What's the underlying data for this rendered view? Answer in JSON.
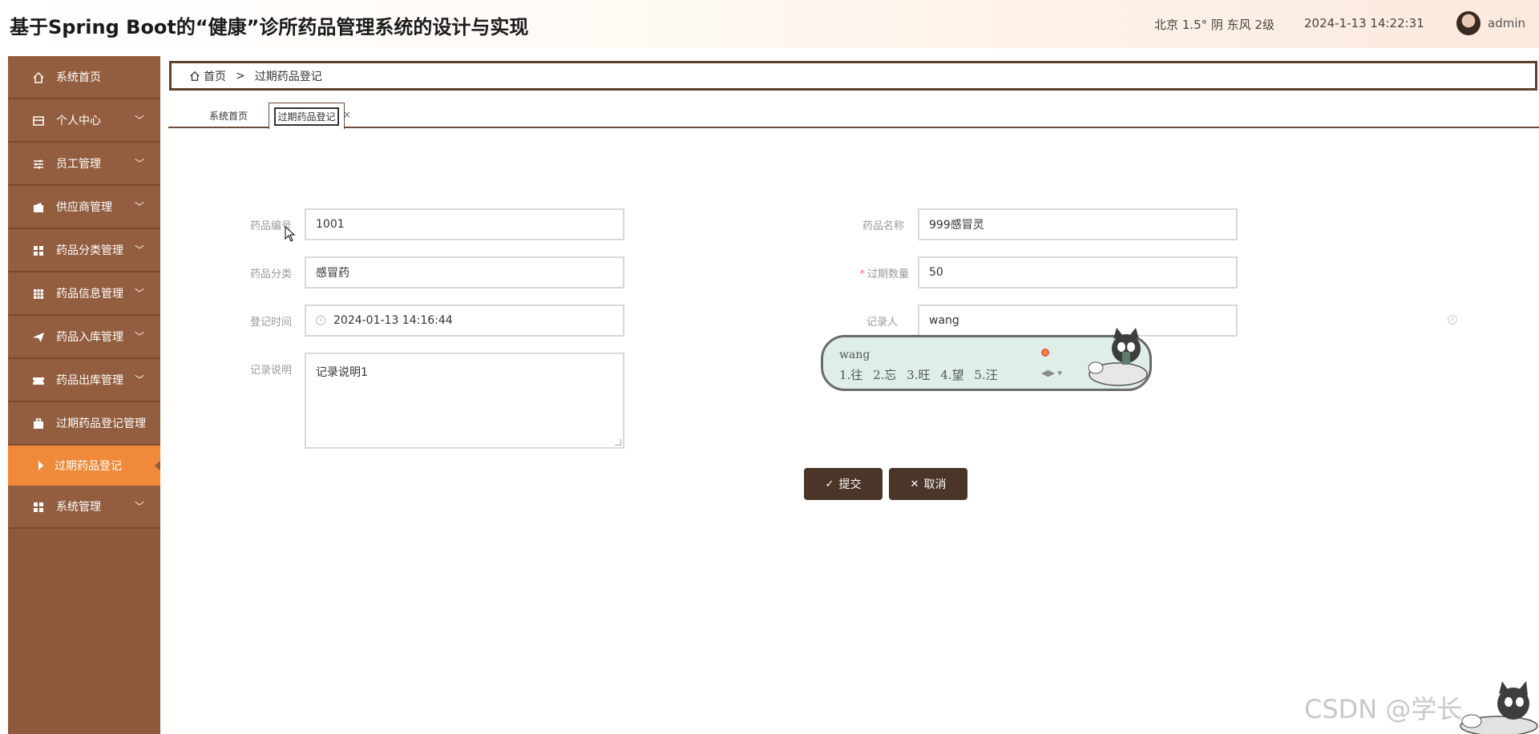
{
  "header": {
    "title": "基于Spring Boot的“健康”诊所药品管理系统的设计与实现",
    "weather": "北京  1.5°  阴  东风  2级",
    "datetime": "2024-1-13 14:22:31",
    "username": "admin"
  },
  "sidebar": {
    "items": [
      {
        "label": "系统首页",
        "icon": "home-icon"
      },
      {
        "label": "个人中心",
        "icon": "user-card-icon"
      },
      {
        "label": "员工管理",
        "icon": "sliders-icon"
      },
      {
        "label": "供应商管理",
        "icon": "wallet-icon"
      },
      {
        "label": "药品分类管理",
        "icon": "grid-icon"
      },
      {
        "label": "药品信息管理",
        "icon": "table-icon"
      },
      {
        "label": "药品入库管理",
        "icon": "send-icon"
      },
      {
        "label": "药品出库管理",
        "icon": "ticket-icon"
      },
      {
        "label": "过期药品登记管理",
        "icon": "briefcase-icon"
      }
    ],
    "active_sub": "过期药品登记",
    "bottom_item": {
      "label": "系统管理",
      "icon": "grid-icon"
    }
  },
  "breadcrumb": {
    "home": "首页",
    "sep": ">",
    "current": "过期药品登记"
  },
  "tabs": [
    {
      "label": "系统首页"
    },
    {
      "label": "过期药品登记"
    }
  ],
  "tab_close": "×",
  "form": {
    "drug_code": {
      "label": "药品编号",
      "value": "1001"
    },
    "drug_name": {
      "label": "药品名称",
      "value": "999感冒灵"
    },
    "drug_category": {
      "label": "药品分类",
      "value": "感冒药"
    },
    "expired_qty": {
      "label": "过期数量",
      "required_mark": "*",
      "value": "50"
    },
    "register_time": {
      "label": "登记时间",
      "value": "2024-01-13 14:16:44"
    },
    "recorder": {
      "label": "记录人",
      "value": "wang"
    },
    "remark": {
      "label": "记录说明",
      "value": "记录说明1"
    }
  },
  "ime": {
    "composition": "wang",
    "candidates": "1.往  2.忘  3.旺  4.望  5.汪"
  },
  "buttons": {
    "submit": "提交",
    "cancel": "取消"
  },
  "watermark": "CSDN @学长"
}
